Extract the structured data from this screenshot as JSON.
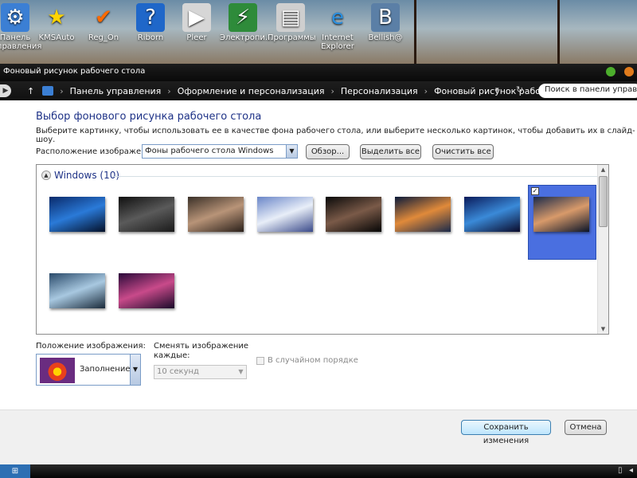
{
  "desktop": {
    "icons": [
      {
        "label": "Панель управления",
        "icon": "control-panel-icon",
        "glyph": "⚙",
        "bg": "#3b7fd4"
      },
      {
        "label": "KMSAuto",
        "icon": "star-icon",
        "glyph": "★",
        "bg": "transparent"
      },
      {
        "label": "Reg_On",
        "icon": "checkmark-icon",
        "glyph": "✔",
        "bg": "transparent"
      },
      {
        "label": "Riborn",
        "icon": "help-icon",
        "glyph": "?",
        "bg": "#1f67c9"
      },
      {
        "label": "Pleer",
        "icon": "media-player-icon",
        "glyph": "▶",
        "bg": "#d6d6d6"
      },
      {
        "label": "Электропи...",
        "icon": "power-icon",
        "glyph": "⚡",
        "bg": "#2e8b3a"
      },
      {
        "label": "Программы",
        "icon": "programs-icon",
        "glyph": "▤",
        "bg": "#cfcfcf"
      },
      {
        "label": "Internet Explorer",
        "icon": "internet-explorer-icon",
        "glyph": "e",
        "bg": "transparent"
      },
      {
        "label": "Bellish@",
        "icon": "vk-icon",
        "glyph": "B",
        "bg": "#5b7fa6"
      }
    ]
  },
  "window": {
    "title": "Фоновый рисунок рабочего стола",
    "breadcrumb": [
      "Панель управления",
      "Оформление и персонализация",
      "Персонализация",
      "Фоновый рисунок рабочего стола"
    ],
    "search_placeholder": "Поиск в панели управления"
  },
  "main": {
    "heading": "Выбор фонового рисунка рабочего стола",
    "description": "Выберите картинку, чтобы использовать ее в качестве фона рабочего стола, или выберите несколько картинок, чтобы добавить их в слайд-шоу.",
    "location_label": "Расположение изображения:",
    "location_value": "Фоны рабочего стола Windows",
    "browse_label": "Обзор...",
    "select_all_label": "Выделить все",
    "clear_all_label": "Очистить все",
    "group_label": "Windows (10)",
    "selected_index": 7,
    "thumbnails": [
      {
        "name": "windows-logo-wallpaper",
        "colors": [
          "#0a2a6a",
          "#2a7ad8",
          "#041028"
        ]
      },
      {
        "name": "dark-figure-wallpaper",
        "colors": [
          "#101010",
          "#5a5a5a",
          "#1a1a1a"
        ]
      },
      {
        "name": "people-wallpaper",
        "colors": [
          "#3a3028",
          "#b89478",
          "#2a201a"
        ]
      },
      {
        "name": "anime-character-wallpaper",
        "colors": [
          "#6a86c8",
          "#e8eef8",
          "#3a4a8a"
        ]
      },
      {
        "name": "portrait-wallpaper",
        "colors": [
          "#0a0a0a",
          "#7a5a48",
          "#050505"
        ]
      },
      {
        "name": "sunset-lake-wallpaper",
        "colors": [
          "#0a1a3a",
          "#e08a3a",
          "#1a2a4a"
        ]
      },
      {
        "name": "horizon-wallpaper",
        "colors": [
          "#0a1a5a",
          "#3a8ad8",
          "#0a0a2a"
        ]
      },
      {
        "name": "sailboat-wallpaper",
        "colors": [
          "#1a2a4a",
          "#d89a6a",
          "#0a1428"
        ]
      },
      {
        "name": "seascape-wallpaper",
        "colors": [
          "#2a4a6a",
          "#a8c8e0",
          "#1a2a3a"
        ]
      },
      {
        "name": "purple-sky-wallpaper",
        "colors": [
          "#2a0a3a",
          "#c84a8a",
          "#1a0a2a"
        ]
      }
    ],
    "position_label": "Положение изображения:",
    "position_value": "Заполнение",
    "change_label": "Сменять изображение каждые:",
    "interval_value": "10 секунд",
    "shuffle_label": "В случайном порядке"
  },
  "footer": {
    "save_label": "Сохранить изменения",
    "cancel_label": "Отмена"
  },
  "colors": {
    "accent": "#1e3287",
    "selection": "#4a6fe0"
  }
}
